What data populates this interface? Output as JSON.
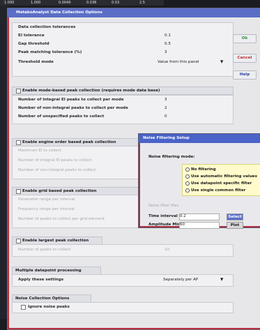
{
  "background_table": {
    "cells": [
      "1.000",
      "1.000",
      "0.0040",
      "0.038",
      "0.03",
      "2.5"
    ]
  },
  "main_dialog": {
    "title": "MetaboAnalyst Data Collection Options",
    "section_tolerances": "Data collection tolerances",
    "ei_tolerance_label": "EI tolerance",
    "ei_tolerance_value": "0.1",
    "gap_threshold_label": "Gap threshold",
    "gap_threshold_value": "0.5",
    "peak_matching_label": "Peak matching tolerance (%)",
    "peak_matching_value": "3",
    "threshold_mode_label": "Threshold mode",
    "threshold_mode_value": "Value from this panel",
    "mode_section_label": "Enable mode-based peak collection (requires mode data base)",
    "integral_ei_label": "Number of integral EI peaks to collect per mode",
    "integral_ei_value": "3",
    "nonintegral_label": "Number of non-integral peaks to collect per mode",
    "nonintegral_value": "2",
    "unspecified_label": "Number of unspecified peaks to collect",
    "unspecified_value": "0",
    "engine_section_label": "Enable engine order based peak collection",
    "engine_row1": "Maximum EI to collect",
    "engine_row2": "Number of integral EI peaks to collect",
    "engine_row3": "Number of non-integral peaks to collect",
    "grid_section_label": "Enable grid based peak collection",
    "grid_row1": "Parameter range per interval",
    "grid_row2": "Frequency range per interval",
    "grid_row3": "Number of peaks to collect per grid element",
    "largest_section_label": "Enable largest peak collection",
    "largest_row1": "Number of peaks to collect",
    "largest_row1_value": "10",
    "multiple_section_label": "Multiple datapoint processing",
    "apply_label": "Apply these settings",
    "apply_value": "Separately per AP",
    "noise_section_label": "Noise Collection Options",
    "noise_row1": "Ignore noise peaks",
    "ok_label": "Ok",
    "cancel_label": "Cancel",
    "help_label": "Help"
  },
  "noise_dialog": {
    "title": "Noise Filtering Setup",
    "noise_mode_label": "Noise filtering mode:",
    "options": [
      "No filtering",
      "Use automatic filtering values",
      "Use datapoint specific filter",
      "Use single common filter"
    ],
    "noise_filter_label": "Noise filter files",
    "time_interval_label": "Time interval",
    "time_interval_value": "0.2",
    "time_interval_button": "Select",
    "amplitude_label": "Amplitude Min",
    "amplitude_value": "60",
    "amplitude_button": "Plot"
  },
  "colors": {
    "title_bar": "#5b6ec6",
    "highlight_border": "#b83040",
    "radio_box": "#fffbcc",
    "ok_green": "#2f8f3a",
    "cancel_red": "#c03030"
  }
}
